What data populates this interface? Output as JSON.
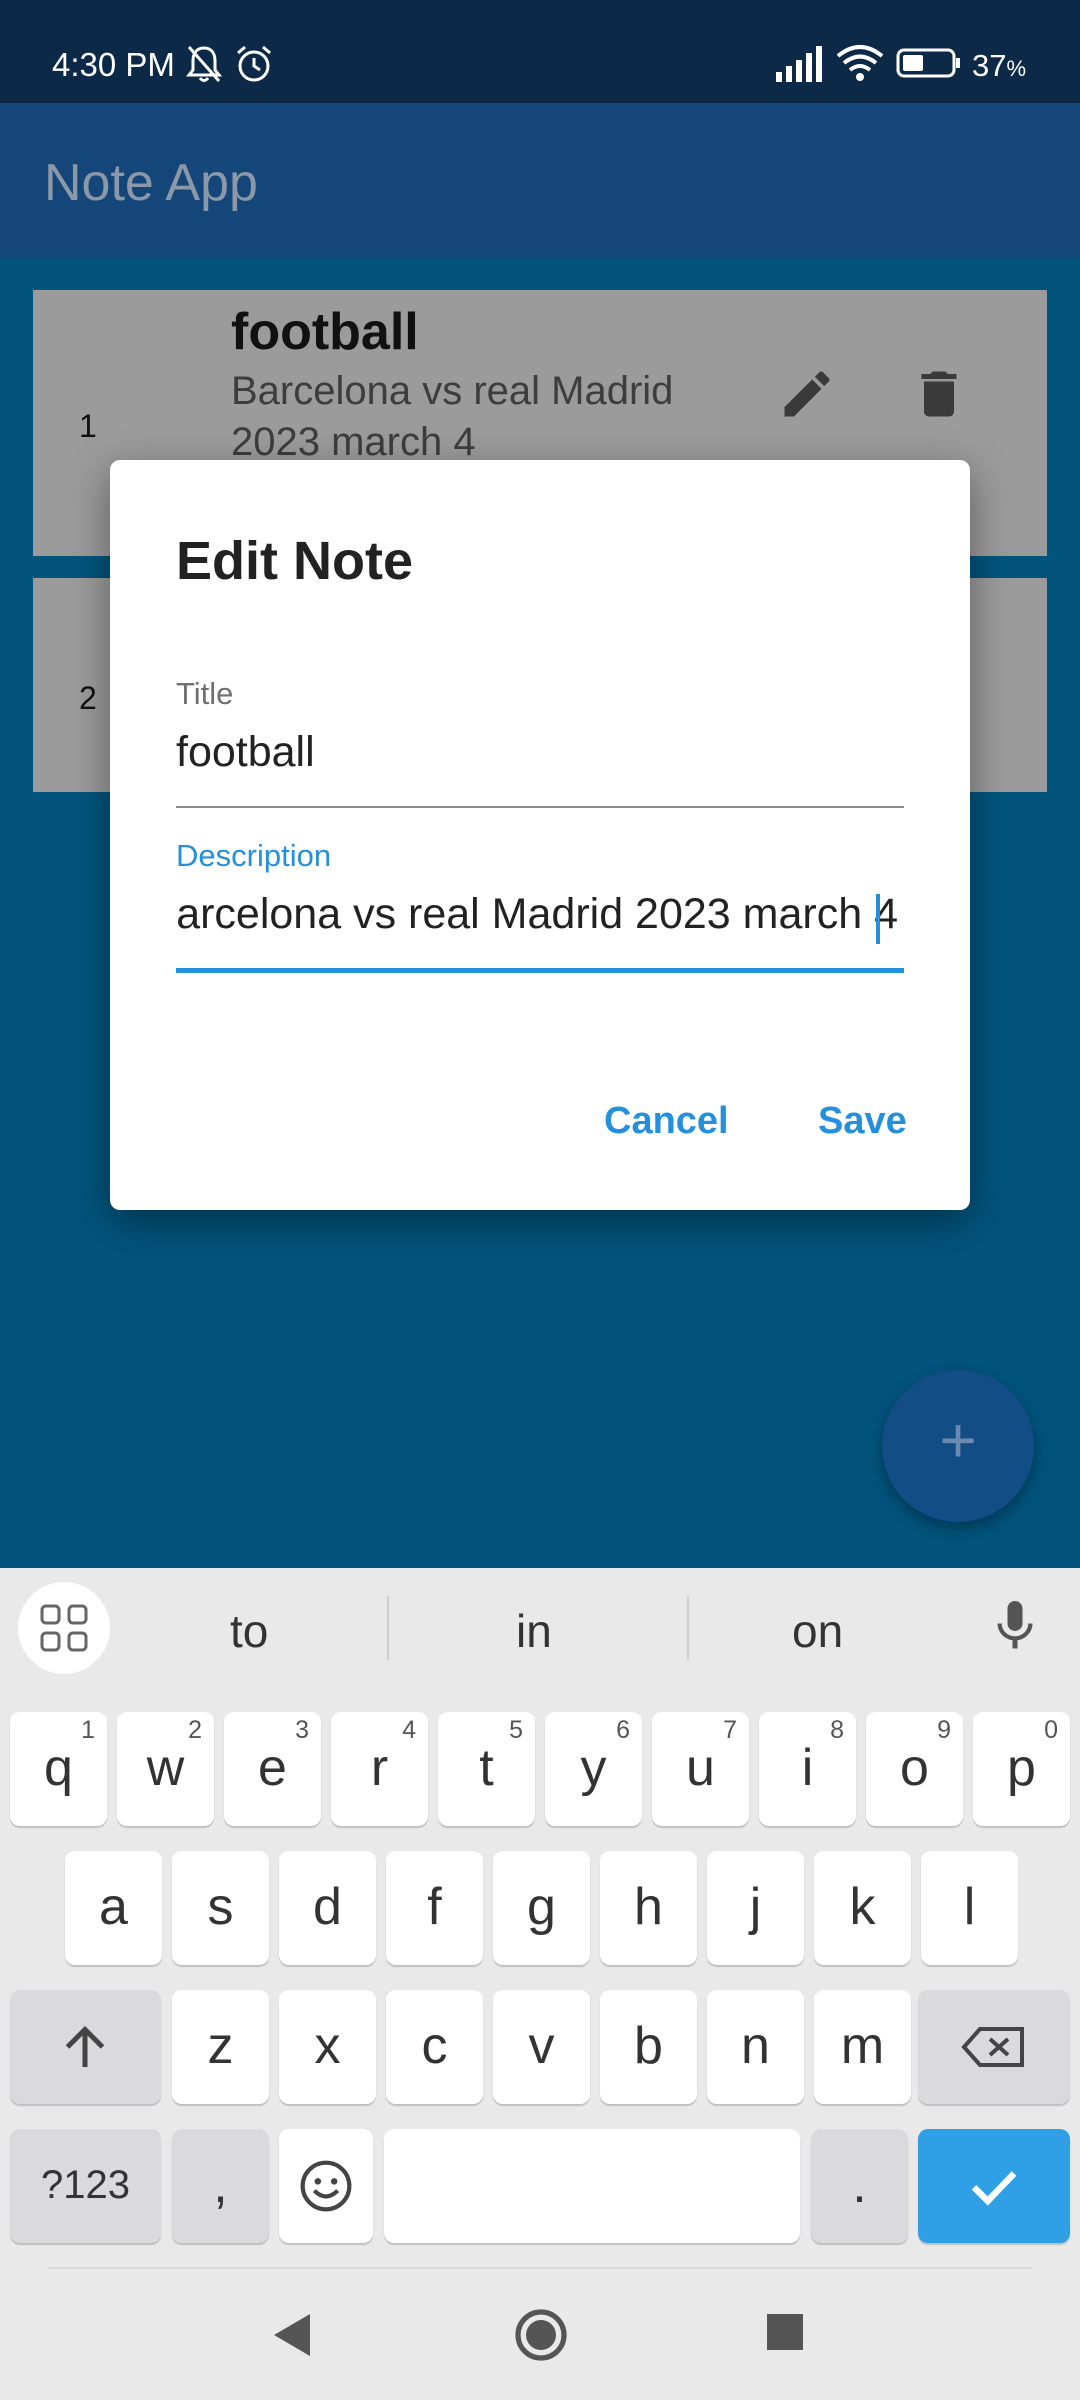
{
  "status_bar": {
    "time": "4:30 PM",
    "battery": "37",
    "battery_unit": "%",
    "icons": [
      "bell-off-icon",
      "alarm-icon",
      "signal-icon",
      "wifi-icon",
      "battery-icon"
    ]
  },
  "app_bar": {
    "title": "Note App"
  },
  "notes": [
    {
      "index": "1",
      "title": "football",
      "description": "Barcelona vs real Madrid 2023 march 4"
    },
    {
      "index": "2",
      "title": "",
      "description": ""
    }
  ],
  "fab": {
    "symbol": "+"
  },
  "dialog": {
    "title": "Edit Note",
    "title_field": {
      "label": "Title",
      "value": "football"
    },
    "description_field": {
      "label": "Description",
      "value": "arcelona vs real Madrid 2023 march 4"
    },
    "cancel_label": "Cancel",
    "save_label": "Save"
  },
  "keyboard": {
    "suggestions": [
      "to",
      "in",
      "on"
    ],
    "row1": [
      "q",
      "w",
      "e",
      "r",
      "t",
      "y",
      "u",
      "i",
      "o",
      "p"
    ],
    "row1_numbers": [
      "1",
      "2",
      "3",
      "4",
      "5",
      "6",
      "7",
      "8",
      "9",
      "0"
    ],
    "row2": [
      "a",
      "s",
      "d",
      "f",
      "g",
      "h",
      "j",
      "k",
      "l"
    ],
    "row3": [
      "z",
      "x",
      "c",
      "v",
      "b",
      "n",
      "m"
    ],
    "symbols_label": "?123",
    "comma": ",",
    "period": "."
  },
  "colors": {
    "accent": "#2490dc",
    "app_bar": "#14467a",
    "background": "#02547d",
    "card": "#9b9b9b",
    "enter_key": "#2f9fe6"
  }
}
